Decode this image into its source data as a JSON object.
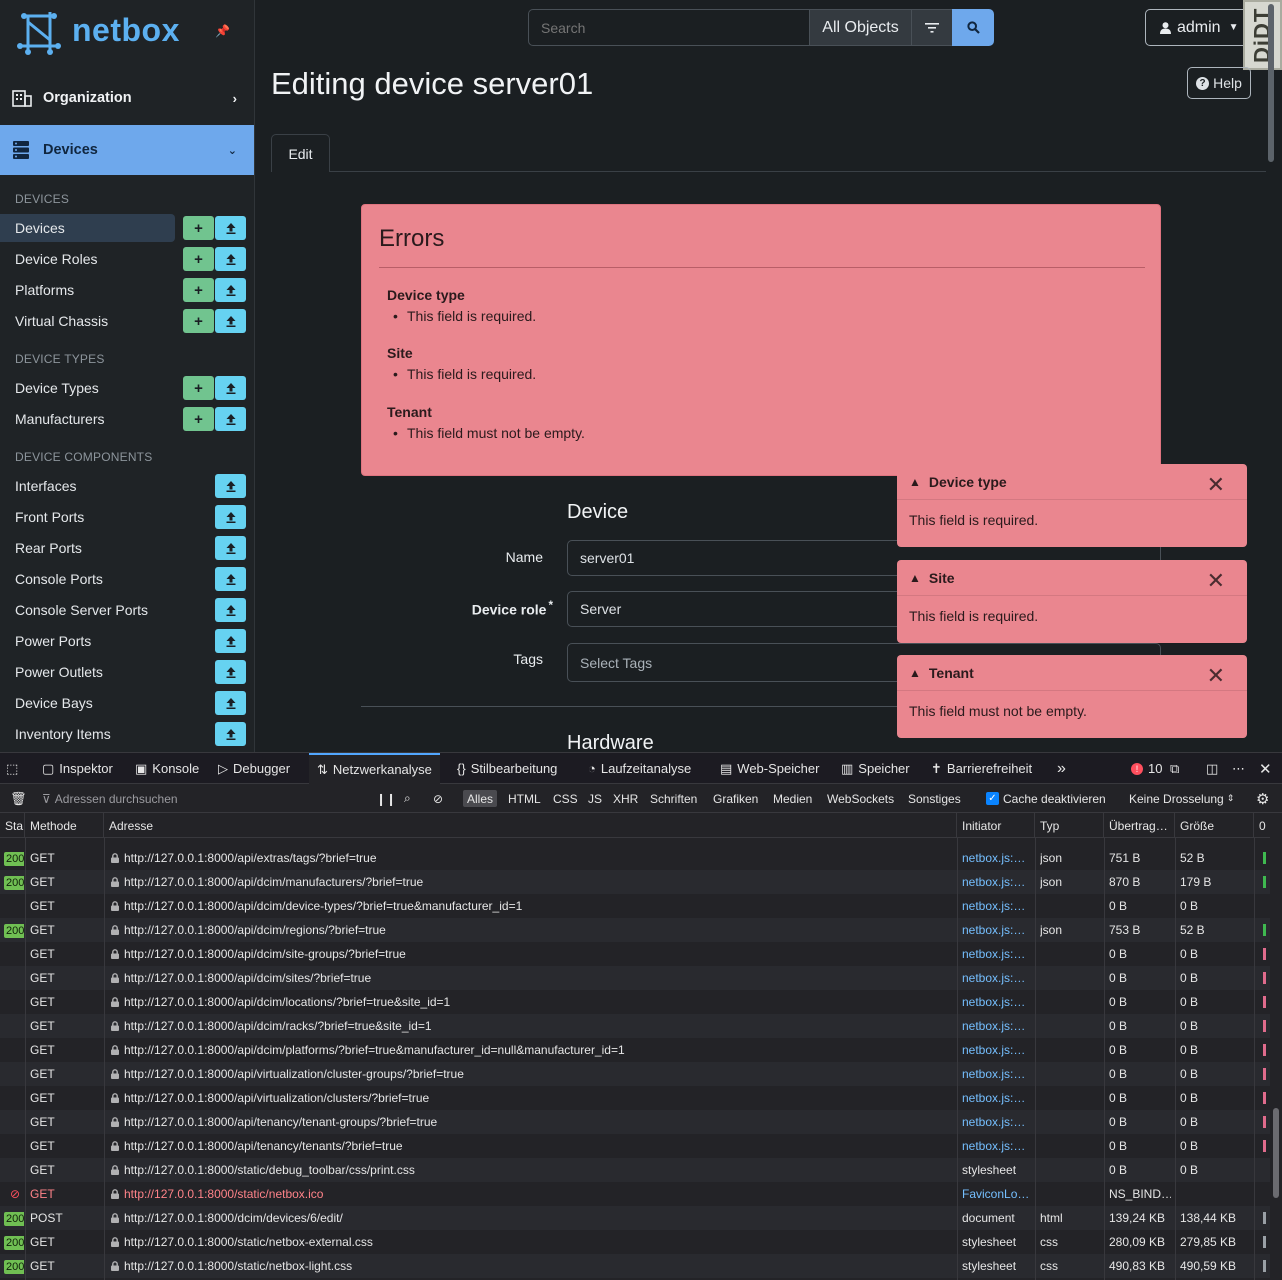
{
  "brand": {
    "name": "netbox"
  },
  "topbar": {
    "search_placeholder": "Search",
    "scope": "All Objects",
    "user": "admin",
    "djdt": "DjDT"
  },
  "sidebar": {
    "organization": "Organization",
    "devices_menu": "Devices",
    "sections": [
      {
        "title": "DEVICES",
        "items": [
          {
            "label": "Devices",
            "add": true,
            "import": true,
            "active": true
          },
          {
            "label": "Device Roles",
            "add": true,
            "import": true
          },
          {
            "label": "Platforms",
            "add": true,
            "import": true
          },
          {
            "label": "Virtual Chassis",
            "add": true,
            "import": true
          }
        ]
      },
      {
        "title": "DEVICE TYPES",
        "items": [
          {
            "label": "Device Types",
            "add": true,
            "import": true
          },
          {
            "label": "Manufacturers",
            "add": true,
            "import": true
          }
        ]
      },
      {
        "title": "DEVICE COMPONENTS",
        "items": [
          {
            "label": "Interfaces",
            "add": false,
            "import": true
          },
          {
            "label": "Front Ports",
            "add": false,
            "import": true
          },
          {
            "label": "Rear Ports",
            "add": false,
            "import": true
          },
          {
            "label": "Console Ports",
            "add": false,
            "import": true
          },
          {
            "label": "Console Server Ports",
            "add": false,
            "import": true
          },
          {
            "label": "Power Ports",
            "add": false,
            "import": true
          },
          {
            "label": "Power Outlets",
            "add": false,
            "import": true
          },
          {
            "label": "Device Bays",
            "add": false,
            "import": true
          },
          {
            "label": "Inventory Items",
            "add": false,
            "import": true
          }
        ]
      }
    ]
  },
  "page": {
    "title": "Editing device server01",
    "help": "Help",
    "tab": "Edit"
  },
  "errors": {
    "title": "Errors",
    "groups": [
      {
        "field": "Device type",
        "message": "This field is required."
      },
      {
        "field": "Site",
        "message": "This field is required."
      },
      {
        "field": "Tenant",
        "message": "This field must not be empty."
      }
    ]
  },
  "form": {
    "section_device": "Device",
    "section_hardware": "Hardware",
    "name_label": "Name",
    "name_value": "server01",
    "role_label": "Device role",
    "role_required": "*",
    "role_value": "Server",
    "tags_label": "Tags",
    "tags_placeholder": "Select Tags"
  },
  "toasts": [
    {
      "title": "Device type",
      "message": "This field is required."
    },
    {
      "title": "Site",
      "message": "This field is required."
    },
    {
      "title": "Tenant",
      "message": "This field must not be empty."
    }
  ],
  "devtools": {
    "tabs": [
      "Inspektor",
      "Konsole",
      "Debugger",
      "Netzwerkanalyse",
      "Stilbearbeitung",
      "Laufzeitanalyse",
      "Web-Speicher",
      "Speicher",
      "Barrierefreiheit"
    ],
    "error_count": "10",
    "filter_placeholder": "Adressen durchsuchen",
    "filters": [
      "Alles",
      "HTML",
      "CSS",
      "JS",
      "XHR",
      "Schriften",
      "Grafiken",
      "Medien",
      "WebSockets",
      "Sonstiges"
    ],
    "cache_label": "Cache deaktivieren",
    "throttle": "Keine Drosselung",
    "columns": [
      "Sta",
      "Methode",
      "Adresse",
      "Initiator",
      "Typ",
      "Übertrag…",
      "Größe",
      "0"
    ],
    "requests": [
      {
        "status": "200",
        "method": "GET",
        "url": "http://127.0.0.1:8000/api/extras/tags/?brief=true",
        "initiator": "netbox.js:…",
        "type": "json",
        "transferred": "751 B",
        "size": "52 B",
        "wf": "#3fb950"
      },
      {
        "status": "200",
        "method": "GET",
        "url": "http://127.0.0.1:8000/api/dcim/manufacturers/?brief=true",
        "initiator": "netbox.js:…",
        "type": "json",
        "transferred": "870 B",
        "size": "179 B",
        "wf": "#3fb950"
      },
      {
        "status": "",
        "method": "GET",
        "url": "http://127.0.0.1:8000/api/dcim/device-types/?brief=true&manufacturer_id=1",
        "initiator": "netbox.js:…",
        "type": "",
        "transferred": "0 B",
        "size": "0 B",
        "wf": ""
      },
      {
        "status": "200",
        "method": "GET",
        "url": "http://127.0.0.1:8000/api/dcim/regions/?brief=true",
        "initiator": "netbox.js:…",
        "type": "json",
        "transferred": "753 B",
        "size": "52 B",
        "wf": "#3fb950"
      },
      {
        "status": "",
        "method": "GET",
        "url": "http://127.0.0.1:8000/api/dcim/site-groups/?brief=true",
        "initiator": "netbox.js:…",
        "type": "",
        "transferred": "0 B",
        "size": "0 B",
        "wf": "#e06b8c"
      },
      {
        "status": "",
        "method": "GET",
        "url": "http://127.0.0.1:8000/api/dcim/sites/?brief=true",
        "initiator": "netbox.js:…",
        "type": "",
        "transferred": "0 B",
        "size": "0 B",
        "wf": "#e06b8c"
      },
      {
        "status": "",
        "method": "GET",
        "url": "http://127.0.0.1:8000/api/dcim/locations/?brief=true&site_id=1",
        "initiator": "netbox.js:…",
        "type": "",
        "transferred": "0 B",
        "size": "0 B",
        "wf": "#e06b8c"
      },
      {
        "status": "",
        "method": "GET",
        "url": "http://127.0.0.1:8000/api/dcim/racks/?brief=true&site_id=1",
        "initiator": "netbox.js:…",
        "type": "",
        "transferred": "0 B",
        "size": "0 B",
        "wf": "#e06b8c"
      },
      {
        "status": "",
        "method": "GET",
        "url": "http://127.0.0.1:8000/api/dcim/platforms/?brief=true&manufacturer_id=null&manufacturer_id=1",
        "initiator": "netbox.js:…",
        "type": "",
        "transferred": "0 B",
        "size": "0 B",
        "wf": "#e06b8c"
      },
      {
        "status": "",
        "method": "GET",
        "url": "http://127.0.0.1:8000/api/virtualization/cluster-groups/?brief=true",
        "initiator": "netbox.js:…",
        "type": "",
        "transferred": "0 B",
        "size": "0 B",
        "wf": "#e06b8c"
      },
      {
        "status": "",
        "method": "GET",
        "url": "http://127.0.0.1:8000/api/virtualization/clusters/?brief=true",
        "initiator": "netbox.js:…",
        "type": "",
        "transferred": "0 B",
        "size": "0 B",
        "wf": "#e06b8c"
      },
      {
        "status": "",
        "method": "GET",
        "url": "http://127.0.0.1:8000/api/tenancy/tenant-groups/?brief=true",
        "initiator": "netbox.js:…",
        "type": "",
        "transferred": "0 B",
        "size": "0 B",
        "wf": "#e06b8c"
      },
      {
        "status": "",
        "method": "GET",
        "url": "http://127.0.0.1:8000/api/tenancy/tenants/?brief=true",
        "initiator": "netbox.js:…",
        "type": "",
        "transferred": "0 B",
        "size": "0 B",
        "wf": "#e06b8c"
      },
      {
        "status": "",
        "method": "GET",
        "url": "http://127.0.0.1:8000/static/debug_toolbar/css/print.css",
        "initiator": "stylesheet",
        "type": "",
        "transferred": "0 B",
        "size": "0 B",
        "wf": "",
        "plain": true
      },
      {
        "status": "blocked",
        "method": "GET",
        "url": "http://127.0.0.1:8000/static/netbox.ico",
        "initiator": "FaviconLo…",
        "type": "",
        "transferred": "NS_BIND…",
        "size": "",
        "wf": "",
        "error": true
      },
      {
        "status": "200",
        "method": "POST",
        "url": "http://127.0.0.1:8000/dcim/devices/6/edit/",
        "initiator": "document",
        "type": "html",
        "transferred": "139,24 KB",
        "size": "138,44 KB",
        "wf": "#9aa0a6",
        "plain": true
      },
      {
        "status": "200",
        "method": "GET",
        "url": "http://127.0.0.1:8000/static/netbox-external.css",
        "initiator": "stylesheet",
        "type": "css",
        "transferred": "280,09 KB",
        "size": "279,85 KB",
        "wf": "#9aa0a6",
        "plain": true
      },
      {
        "status": "200",
        "method": "GET",
        "url": "http://127.0.0.1:8000/static/netbox-light.css",
        "initiator": "stylesheet",
        "type": "css",
        "transferred": "490,83 KB",
        "size": "490,59 KB",
        "wf": "#9aa0a6",
        "plain": true
      }
    ]
  }
}
